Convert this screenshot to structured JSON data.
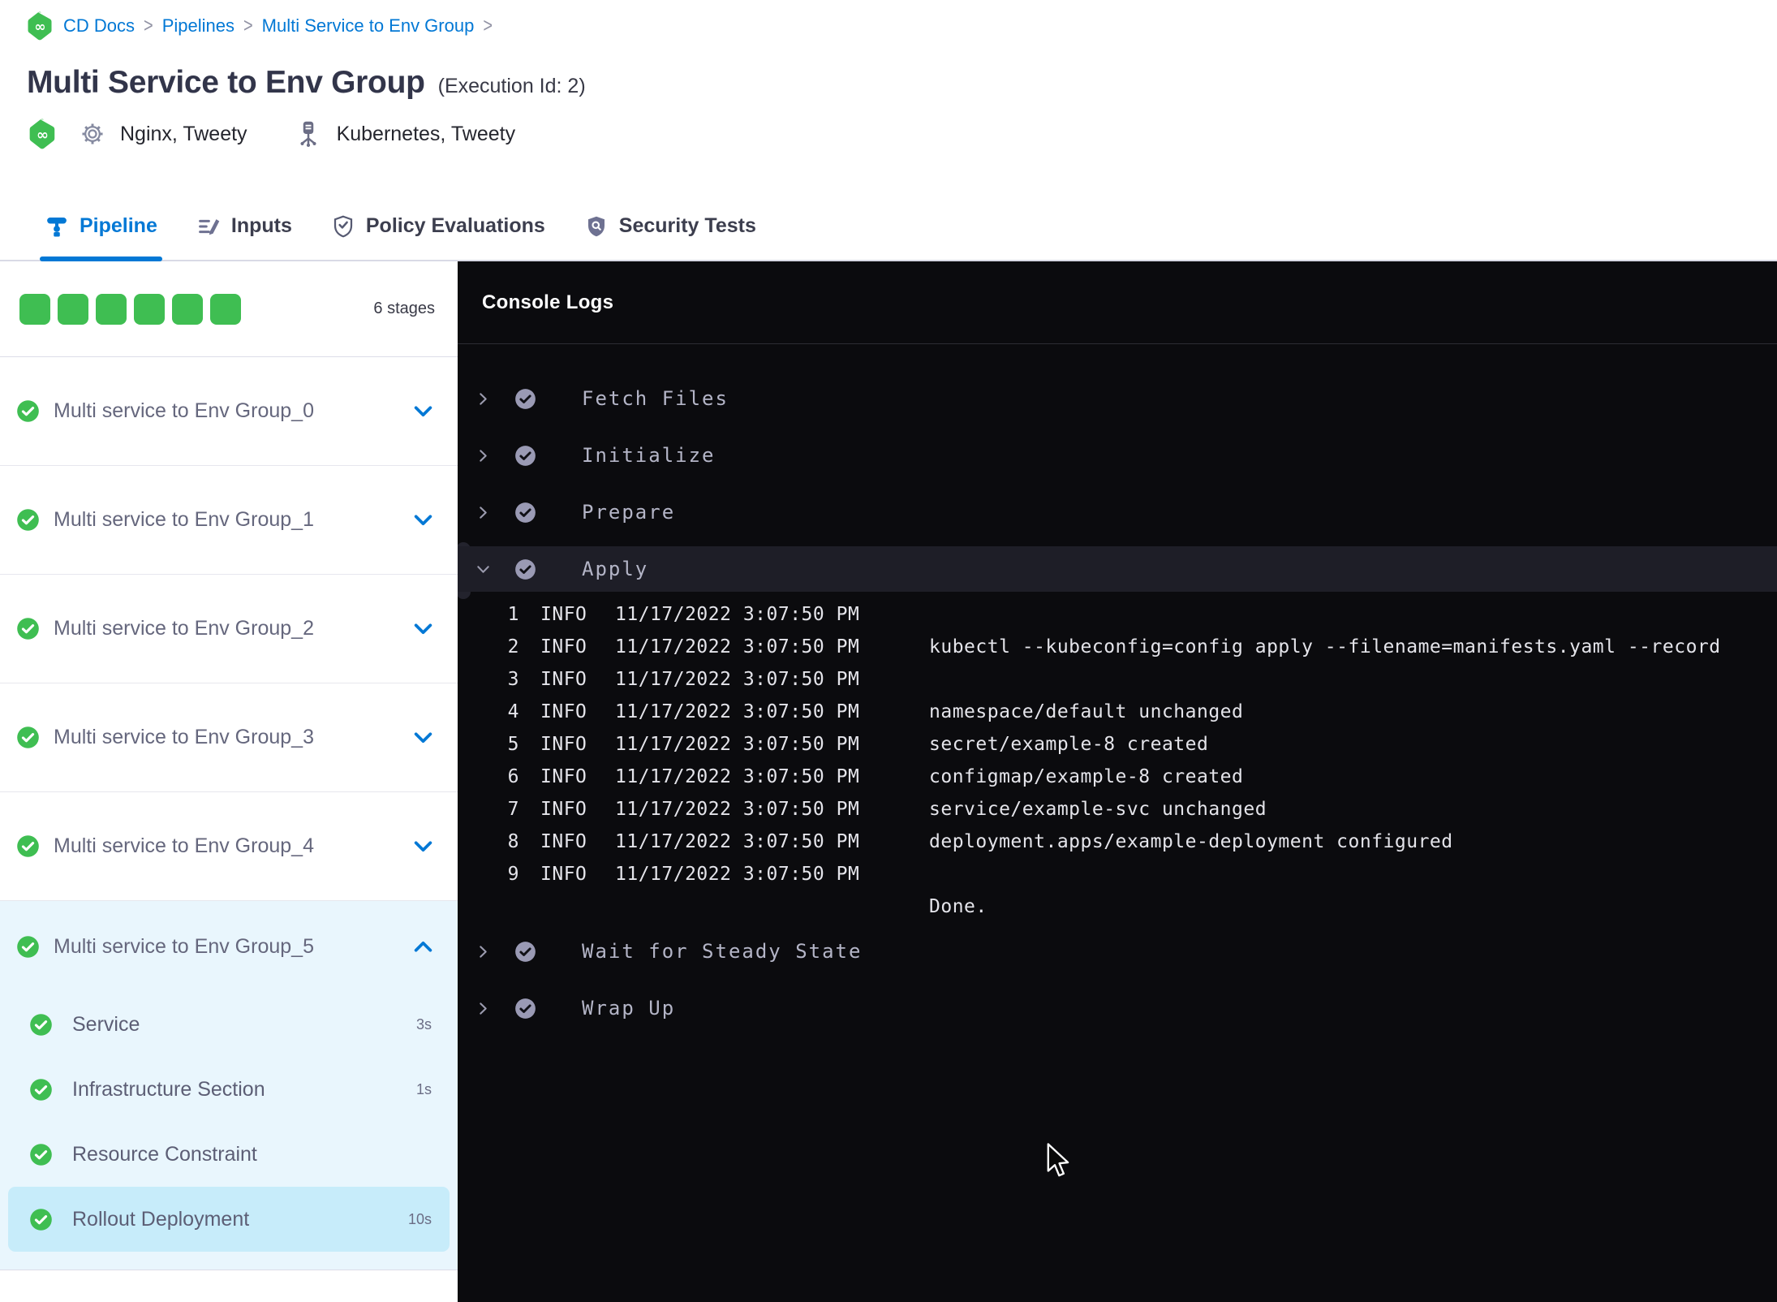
{
  "breadcrumb": {
    "items": [
      "CD Docs",
      "Pipelines",
      "Multi Service to Env Group"
    ],
    "separator": ">"
  },
  "header": {
    "title": "Multi Service to Env Group",
    "execution_id": "(Execution Id: 2)",
    "services_label": "Nginx, Tweety",
    "infrastructure_label": "Kubernetes, Tweety"
  },
  "tabs": [
    {
      "label": "Pipeline",
      "active": true
    },
    {
      "label": "Inputs",
      "active": false
    },
    {
      "label": "Policy Evaluations",
      "active": false
    },
    {
      "label": "Security Tests",
      "active": false
    }
  ],
  "sidebar": {
    "total_stages": 6,
    "stage_count_label": "6 stages",
    "stages": [
      {
        "label": "Multi service to Env Group_0",
        "status": "success",
        "expanded": false
      },
      {
        "label": "Multi service to Env Group_1",
        "status": "success",
        "expanded": false
      },
      {
        "label": "Multi service to Env Group_2",
        "status": "success",
        "expanded": false
      },
      {
        "label": "Multi service to Env Group_3",
        "status": "success",
        "expanded": false
      },
      {
        "label": "Multi service to Env Group_4",
        "status": "success",
        "expanded": false
      },
      {
        "label": "Multi service to Env Group_5",
        "status": "success",
        "expanded": true,
        "steps": [
          {
            "label": "Service",
            "duration": "3s",
            "selected": false
          },
          {
            "label": "Infrastructure Section",
            "duration": "1s",
            "selected": false
          },
          {
            "label": "Resource Constraint",
            "duration": "",
            "selected": false
          },
          {
            "label": "Rollout Deployment",
            "duration": "10s",
            "selected": true
          }
        ]
      }
    ]
  },
  "console": {
    "title": "Console Logs",
    "steps": [
      {
        "label": "Fetch Files",
        "expanded": false
      },
      {
        "label": "Initialize",
        "expanded": false
      },
      {
        "label": "Prepare",
        "expanded": false
      },
      {
        "label": "Apply",
        "expanded": true
      },
      {
        "label": "Wait for Steady State",
        "expanded": false
      },
      {
        "label": "Wrap Up",
        "expanded": false
      }
    ],
    "logs": [
      {
        "num": "1",
        "level": "INFO",
        "ts": "11/17/2022 3:07:50 PM",
        "msg": ""
      },
      {
        "num": "2",
        "level": "INFO",
        "ts": "11/17/2022 3:07:50 PM",
        "msg": "kubectl --kubeconfig=config apply --filename=manifests.yaml --record"
      },
      {
        "num": "3",
        "level": "INFO",
        "ts": "11/17/2022 3:07:50 PM",
        "msg": ""
      },
      {
        "num": "4",
        "level": "INFO",
        "ts": "11/17/2022 3:07:50 PM",
        "msg": "namespace/default unchanged"
      },
      {
        "num": "5",
        "level": "INFO",
        "ts": "11/17/2022 3:07:50 PM",
        "msg": "secret/example-8 created"
      },
      {
        "num": "6",
        "level": "INFO",
        "ts": "11/17/2022 3:07:50 PM",
        "msg": "configmap/example-8 created"
      },
      {
        "num": "7",
        "level": "INFO",
        "ts": "11/17/2022 3:07:50 PM",
        "msg": "service/example-svc unchanged"
      },
      {
        "num": "8",
        "level": "INFO",
        "ts": "11/17/2022 3:07:50 PM",
        "msg": "deployment.apps/example-deployment configured"
      },
      {
        "num": "9",
        "level": "INFO",
        "ts": "11/17/2022 3:07:50 PM",
        "msg": ""
      }
    ],
    "done_label": "Done."
  },
  "colors": {
    "accent_blue": "#0278d5",
    "success_green": "#3fbe52",
    "console_bg": "#0b0b0e",
    "console_row_highlight": "#1e1e27",
    "console_step_icon": "#9a9ab4",
    "expanded_stage_bg": "#e9f6fd",
    "selected_step_bg": "#c7ecfa",
    "log_text": "#e4e4ea"
  }
}
